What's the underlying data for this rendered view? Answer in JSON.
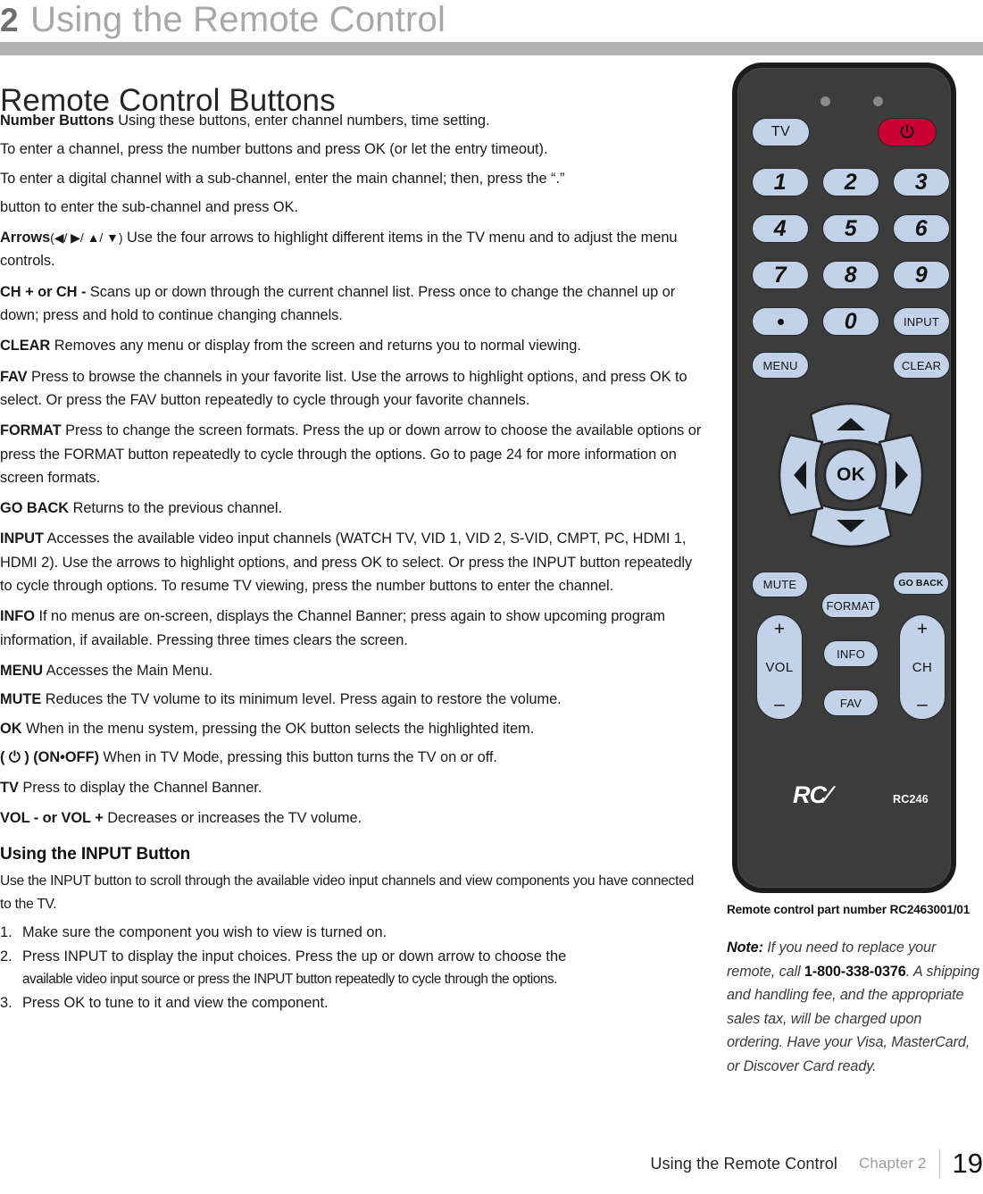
{
  "header": {
    "chapter_number": "2",
    "chapter_title": "Using the Remote Control"
  },
  "page_title": "Remote Control Buttons",
  "body": {
    "paragraphs": [
      {
        "term": "Number Buttons",
        "text": " Using these buttons, enter channel numbers, time setting.",
        "extra_lines": [
          "To enter a channel, press the number buttons and press OK (or let the entry timeout).",
          "To enter a digital channel with a sub-channel, enter the main channel; then, press the “.”",
          "button to enter the sub-channel and press OK."
        ]
      },
      {
        "term": "Arrows",
        "arrows": "(◀/ ▶/ ▲/ ▼)",
        "text": " Use the four arrows to highlight different items in the TV menu and to adjust the menu controls."
      },
      {
        "term": "CH + or CH -",
        "text": " Scans up or down through the current channel list. Press once to change the channel up or down; press and hold to continue changing channels."
      },
      {
        "term": "CLEAR",
        "text": "  Removes any menu or display from the screen and returns you to normal viewing."
      },
      {
        "term": "FAV",
        "text": " Press to browse the channels in your favorite list. Use the arrows to highlight options, and press OK to select.  Or press the FAV button repeatedly to cycle through your favorite channels."
      },
      {
        "term": "FORMAT",
        "text": "  Press to change the screen formats. Press the up or down arrow to choose the available options or press the FORMAT button repeatedly to cycle through the options. Go to page 24 for more information on screen formats."
      },
      {
        "term": "GO BACK",
        "text": " Returns to the previous channel."
      },
      {
        "term": "INPUT",
        "text": " Accesses the available video input channels (WATCH TV, VID 1, VID 2, S-VID, CMPT, PC, HDMI 1, HDMI 2). Use the arrows to highlight options, and press OK to select. Or press the INPUT button repeatedly to cycle through options.  To resume TV viewing, press the number buttons to enter the channel."
      },
      {
        "term": "INFO",
        "text": " If no menus are on-screen, displays the Channel Banner; press again to show upcoming program information, if available. Pressing three times clears the screen."
      },
      {
        "term": "MENU",
        "text": " Accesses the Main Menu."
      },
      {
        "term": "MUTE",
        "text": " Reduces the TV volume to its minimum level. Press again to restore the volume."
      },
      {
        "term": "OK",
        "text": " When in the menu system, pressing the OK button selects the highlighted item."
      },
      {
        "term": "( ⏻ ) (ON•OFF)",
        "text": "  When in TV Mode, pressing this button turns the TV on or off."
      },
      {
        "term": "TV",
        "text": "  Press to display the Channel Banner."
      },
      {
        "term": "VOL - or VOL +",
        "text": " Decreases or increases the TV volume."
      }
    ],
    "input_section": {
      "heading": "Using the INPUT Button",
      "intro": "Use the INPUT button to scroll through the available video input channels and view components you have connected to the TV.",
      "steps": [
        {
          "num": "1.",
          "text": "Make sure the component you wish to view is turned on."
        },
        {
          "num": "2.",
          "text": "Press INPUT to display the input choices.  Press the up or down arrow to choose the",
          "cont": "available video input source or press the INPUT button repeatedly to cycle through the options."
        },
        {
          "num": "3.",
          "text": "Press OK to tune to it and view the component."
        }
      ]
    }
  },
  "remote": {
    "colors": {
      "body": "#3c3c3c",
      "outline": "#1c1c1c",
      "button": "#c2d3e9",
      "power": "#cc0033",
      "logo_text": "#ffffff"
    },
    "buttons": {
      "tv": "TV",
      "power": "power-symbol",
      "num1": "1",
      "num2": "2",
      "num3": "3",
      "num4": "4",
      "num5": "5",
      "num6": "6",
      "num7": "7",
      "num8": "8",
      "num9": "9",
      "dot": "•",
      "num0": "0",
      "input": "INPUT",
      "menu": "MENU",
      "clear": "CLEAR",
      "ok": "OK",
      "up": "up-arrow",
      "down": "down-arrow",
      "left": "left-arrow",
      "right": "right-arrow",
      "mute": "MUTE",
      "go_back": "GO BACK",
      "format": "FORMAT",
      "info": "INFO",
      "fav": "FAV",
      "vol_plus": "+",
      "vol_label": "VOL",
      "vol_minus": "–",
      "ch_plus": "+",
      "ch_label": "CH",
      "ch_minus": "–"
    },
    "brand": "RC∕",
    "model": "RC246",
    "caption": "Remote control part number RC2463001/01"
  },
  "note": {
    "label": "Note:",
    "text_before": " If you need to replace your remote, call ",
    "phone": "1-800-338-0376",
    "text_after": ". A shipping and handling fee, and the appropriate sales tax, will be charged upon ordering. Have your Visa, MasterCard, or Discover Card ready."
  },
  "footer": {
    "section": "Using the Remote Control",
    "chapter": "Chapter 2",
    "page": "19"
  }
}
